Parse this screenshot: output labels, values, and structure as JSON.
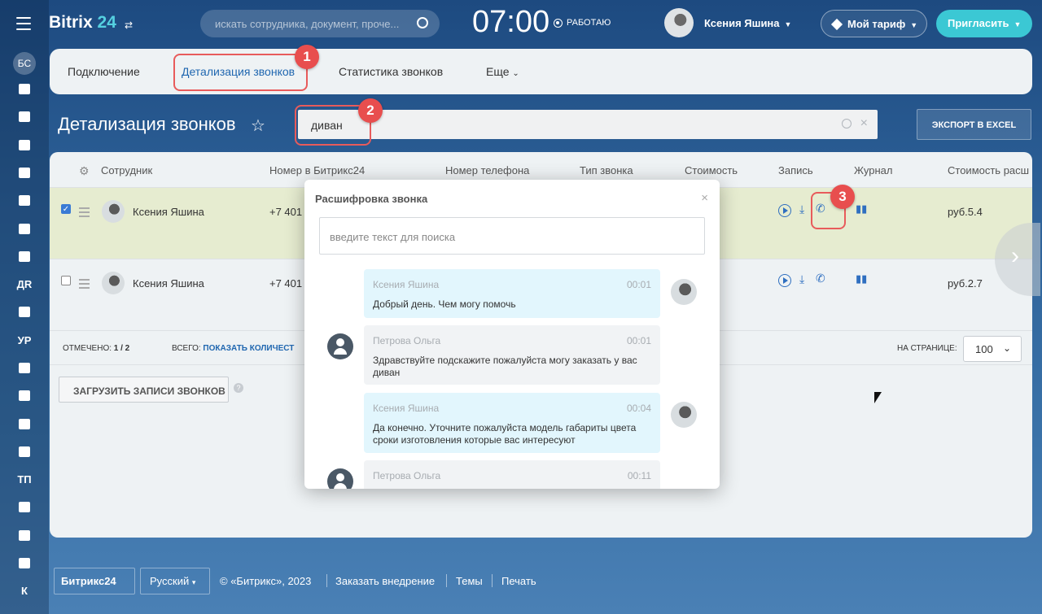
{
  "topbar": {
    "logo_text": "Bitrix",
    "logo_num": "24",
    "search_placeholder": "искать сотрудника, документ, проче...",
    "time": "07:00",
    "status": "РАБОТАЮ",
    "user_name": "Ксения Яшина",
    "tariff": "Мой тариф",
    "invite": "Пригласить"
  },
  "sidebar": {
    "labels": [
      "БС",
      "ДR",
      "УР",
      "ТП",
      "К"
    ]
  },
  "tabs": [
    {
      "label": "Подключение"
    },
    {
      "label": "Детализация звонков",
      "active": true
    },
    {
      "label": "Статистика звонков"
    },
    {
      "label": "Еще"
    }
  ],
  "page": {
    "title": "Детализация звонков",
    "filter_value": "диван",
    "export": "ЭКСПОРТ В EXCEL"
  },
  "annotations": [
    "1",
    "2",
    "3"
  ],
  "grid": {
    "columns": [
      "Сотрудник",
      "Номер в Битрикс24",
      "Номер телефона",
      "Тип звонка",
      "Стоимость",
      "Запись",
      "Журнал",
      "Стоимость расш"
    ],
    "rows": [
      {
        "checked": true,
        "employee": "Ксения Яшина",
        "number": "+7 401",
        "cost_ext": "руб.5.4"
      },
      {
        "checked": false,
        "employee": "Ксения Яшина",
        "number": "+7 401",
        "cost_ext": "руб.2.7"
      }
    ],
    "marked_label": "ОТМЕЧЕНО:",
    "marked_value": "1 / 2",
    "total_label": "ВСЕГО:",
    "total_link": "ПОКАЗАТЬ КОЛИЧЕСТ",
    "per_page_label": "НА СТРАНИЦЕ:",
    "per_page_value": "100",
    "load_button": "ЗАГРУЗИТЬ ЗАПИСИ ЗВОНКОВ"
  },
  "modal": {
    "title": "Расшифровка звонка",
    "search_placeholder": "введите текст для поиска",
    "messages": [
      {
        "author": "Ксения Яшина",
        "time": "00:01",
        "text": "Добрый день. Чем могу помочь",
        "side": "me"
      },
      {
        "author": "Петрова Ольга",
        "time": "00:01",
        "text": "Здравствуйте подскажите пожалуйста могу заказать у вас диван",
        "side": "other"
      },
      {
        "author": "Ксения Яшина",
        "time": "00:04",
        "text": "Да конечно. Уточните пожалуйста модель габариты цвета сроки изготовления которые вас интересуют",
        "side": "me"
      },
      {
        "author": "Петрова Ольга",
        "time": "00:11",
        "text": "",
        "side": "other"
      }
    ]
  },
  "footer": {
    "brand": "Битрикс24",
    "lang": "Русский",
    "copyright": "© «Битрикс», 2023",
    "links": [
      "Заказать внедрение",
      "Темы",
      "Печать"
    ]
  },
  "colors": {
    "accent": "#2067b0",
    "highlight": "#e85b5b",
    "invite": "#3bc8d4",
    "selected_row": "#e6ecd0"
  }
}
